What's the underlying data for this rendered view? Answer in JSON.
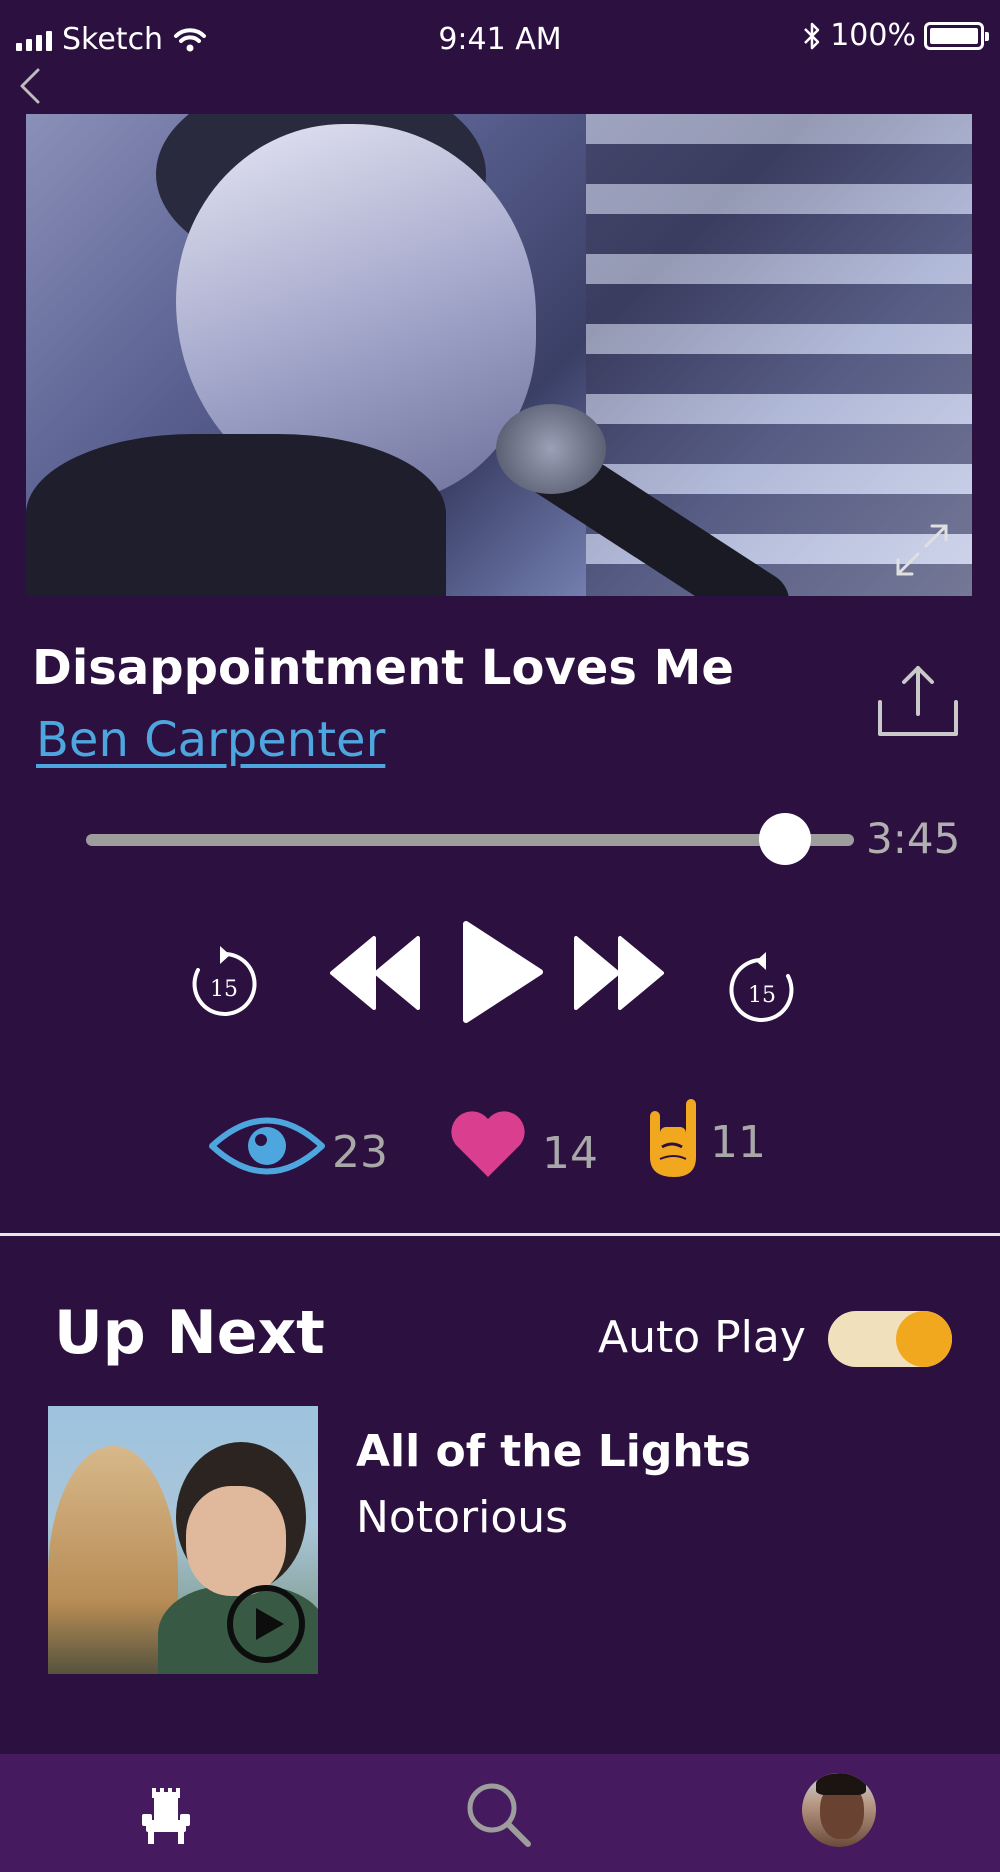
{
  "status_bar": {
    "carrier": "Sketch",
    "time": "9:41 AM",
    "battery": "100%"
  },
  "video": {
    "expand_icon": "expand-icon"
  },
  "song": {
    "title": "Disappointment Loves Me",
    "artist": "Ben Carpenter",
    "share_icon": "share-icon"
  },
  "player": {
    "duration": "3:45",
    "progress": 0.91,
    "skip_back_label": "15",
    "skip_forward_label": "15"
  },
  "stats": {
    "views": "23",
    "likes": "14",
    "rocks": "11"
  },
  "up_next": {
    "heading": "Up Next",
    "autoplay_label": "Auto Play",
    "autoplay_on": true,
    "item": {
      "title": "All of the Lights",
      "artist": "Notorious"
    }
  },
  "tabbar": {
    "items": [
      "throne-icon",
      "search-icon",
      "profile-avatar"
    ]
  },
  "colors": {
    "background": "#2c1040",
    "tabbar": "#451a5e",
    "link": "#4ea6de",
    "eye": "#4ea6de",
    "heart": "#d93f8e",
    "rock_hand": "#f1a81f",
    "toggle_knob": "#f1a81f",
    "toggle_track": "#f1e0bc"
  }
}
